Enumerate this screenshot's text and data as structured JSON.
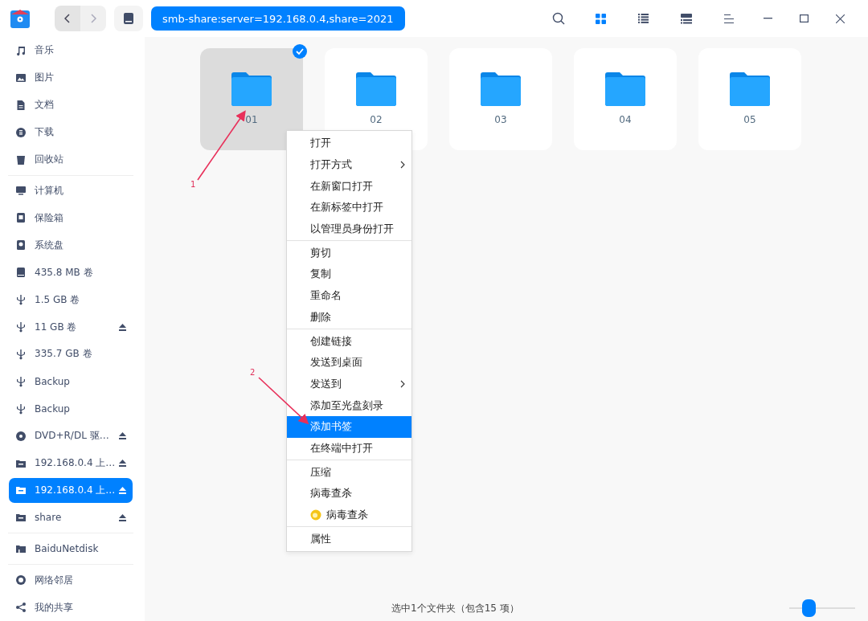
{
  "toolbar": {
    "address": "smb-share:server=192.168.0.4,share=2021",
    "view_modes": [
      {
        "kind": "icons",
        "selected": true
      },
      {
        "kind": "list",
        "selected": false
      },
      {
        "kind": "detail",
        "selected": false
      }
    ]
  },
  "sidebar": {
    "groups": [
      [
        {
          "kind": "music",
          "label": "音乐",
          "eject": false,
          "selected": false
        },
        {
          "kind": "image",
          "label": "图片",
          "eject": false,
          "selected": false
        },
        {
          "kind": "document",
          "label": "文档",
          "eject": false,
          "selected": false
        },
        {
          "kind": "download",
          "label": "下载",
          "eject": false,
          "selected": false
        },
        {
          "kind": "trash",
          "label": "回收站",
          "eject": false,
          "selected": false
        }
      ],
      [
        {
          "kind": "computer",
          "label": "计算机",
          "eject": false,
          "selected": false
        },
        {
          "kind": "vault",
          "label": "保险箱",
          "eject": false,
          "selected": false
        },
        {
          "kind": "disk",
          "label": "系统盘",
          "eject": false,
          "selected": false
        },
        {
          "kind": "drive",
          "label": "435.8 MB 卷",
          "eject": false,
          "selected": false
        },
        {
          "kind": "usb",
          "label": "1.5 GB 卷",
          "eject": false,
          "selected": false
        },
        {
          "kind": "usb",
          "label": "11 GB 卷",
          "eject": true,
          "selected": false
        },
        {
          "kind": "usb",
          "label": "335.7 GB 卷",
          "eject": false,
          "selected": false
        },
        {
          "kind": "usb",
          "label": "Backup",
          "eject": false,
          "selected": false
        },
        {
          "kind": "usb",
          "label": "Backup",
          "eject": false,
          "selected": false
        },
        {
          "kind": "dvd",
          "label": "DVD+R/DL 驱…",
          "eject": true,
          "selected": false
        },
        {
          "kind": "smb",
          "label": "192.168.0.4 上…",
          "eject": true,
          "selected": false
        },
        {
          "kind": "smb",
          "label": "192.168.0.4 上…",
          "eject": true,
          "selected": true
        },
        {
          "kind": "smb",
          "label": "share",
          "eject": true,
          "selected": false
        }
      ],
      [
        {
          "kind": "netdisk",
          "label": "BaiduNetdisk",
          "eject": false,
          "selected": false
        }
      ],
      [
        {
          "kind": "network",
          "label": "网络邻居",
          "eject": false,
          "selected": false
        },
        {
          "kind": "share",
          "label": "我的共享",
          "eject": false,
          "selected": false
        }
      ]
    ]
  },
  "folders": [
    {
      "name": "01",
      "selected": true
    },
    {
      "name": "02",
      "selected": false
    },
    {
      "name": "03",
      "selected": false
    },
    {
      "name": "04",
      "selected": false
    },
    {
      "name": "05",
      "selected": false
    }
  ],
  "context_menu": [
    [
      {
        "label": "打开",
        "submenu": false,
        "selected": false,
        "kind": "plain"
      },
      {
        "label": "打开方式",
        "submenu": true,
        "selected": false,
        "kind": "plain"
      },
      {
        "label": "在新窗口打开",
        "submenu": false,
        "selected": false,
        "kind": "plain"
      },
      {
        "label": "在新标签中打开",
        "submenu": false,
        "selected": false,
        "kind": "plain"
      },
      {
        "label": "以管理员身份打开",
        "submenu": false,
        "selected": false,
        "kind": "plain"
      }
    ],
    [
      {
        "label": "剪切",
        "submenu": false,
        "selected": false,
        "kind": "plain"
      },
      {
        "label": "复制",
        "submenu": false,
        "selected": false,
        "kind": "plain"
      },
      {
        "label": "重命名",
        "submenu": false,
        "selected": false,
        "kind": "plain"
      },
      {
        "label": "删除",
        "submenu": false,
        "selected": false,
        "kind": "plain"
      }
    ],
    [
      {
        "label": "创建链接",
        "submenu": false,
        "selected": false,
        "kind": "plain"
      },
      {
        "label": "发送到桌面",
        "submenu": false,
        "selected": false,
        "kind": "plain"
      },
      {
        "label": "发送到",
        "submenu": true,
        "selected": false,
        "kind": "plain"
      },
      {
        "label": "添加至光盘刻录",
        "submenu": false,
        "selected": false,
        "kind": "plain"
      },
      {
        "label": "添加书签",
        "submenu": false,
        "selected": true,
        "kind": "plain"
      },
      {
        "label": "在终端中打开",
        "submenu": false,
        "selected": false,
        "kind": "plain"
      }
    ],
    [
      {
        "label": "压缩",
        "submenu": false,
        "selected": false,
        "kind": "plain"
      },
      {
        "label": "病毒查杀",
        "submenu": false,
        "selected": false,
        "kind": "plain"
      },
      {
        "label": "病毒查杀",
        "submenu": false,
        "selected": false,
        "kind": "app"
      }
    ],
    [
      {
        "label": "属性",
        "submenu": false,
        "selected": false,
        "kind": "plain"
      }
    ]
  ],
  "annotations": [
    {
      "label": "1"
    },
    {
      "label": "2"
    }
  ],
  "status_bar": {
    "text": "选中1个文件夹（包含15 项）",
    "zoom": {
      "level": 0.25
    }
  }
}
